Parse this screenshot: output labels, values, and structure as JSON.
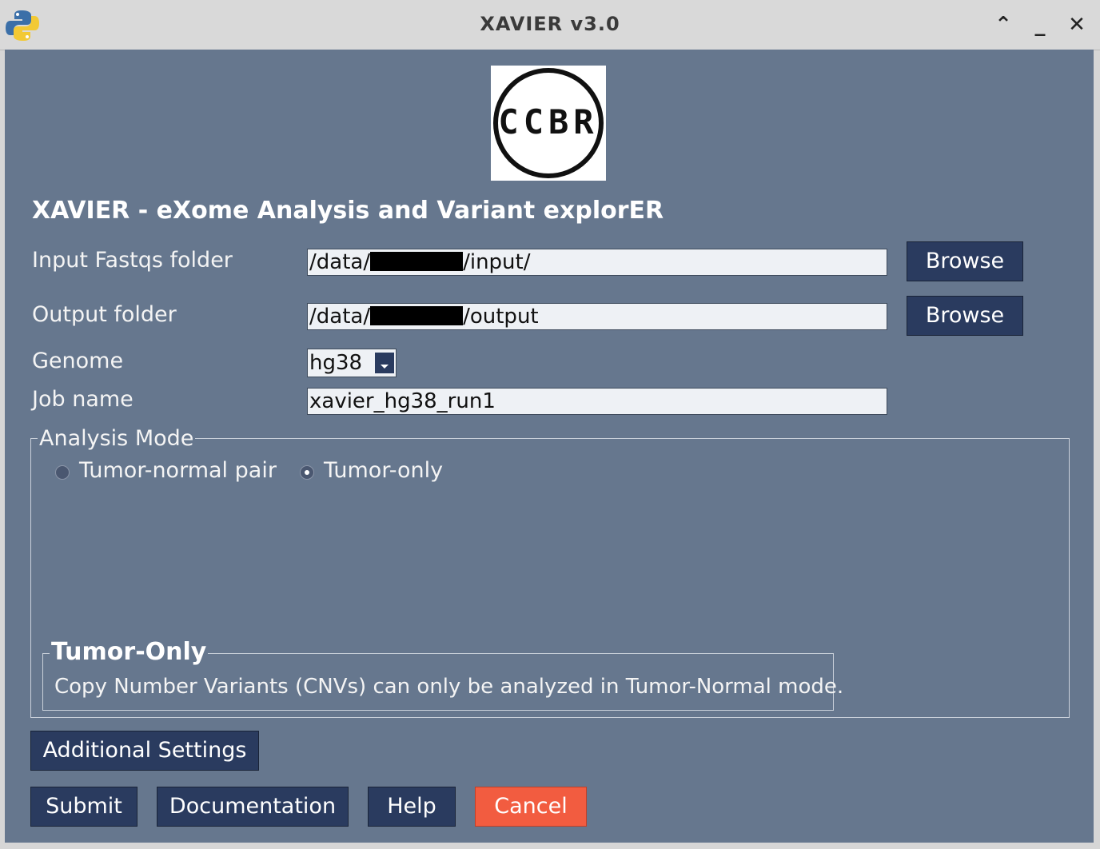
{
  "window": {
    "title": "XAVIER v3.0",
    "controls": {
      "maximize": "⌃",
      "minimize": "_",
      "close": "✕"
    }
  },
  "logo": {
    "text": "CCBR"
  },
  "heading": "XAVIER - eXome Analysis and Variant explorER",
  "form": {
    "input_label": "Input Fastqs folder",
    "input_value_prefix": "/data/",
    "input_value_suffix": "/input/",
    "output_label": "Output folder",
    "output_value_prefix": "/data/",
    "output_value_suffix": "/output",
    "browse_label": "Browse",
    "genome_label": "Genome",
    "genome_value": "hg38",
    "jobname_label": "Job name",
    "jobname_value": "xavier_hg38_run1"
  },
  "analysis_mode": {
    "legend": "Analysis Mode",
    "options": [
      "Tumor-normal pair",
      "Tumor-only"
    ],
    "selected": "Tumor-only",
    "info_legend": "Tumor-Only",
    "info_text": "Copy Number Variants (CNVs) can only be analyzed in Tumor-Normal mode."
  },
  "buttons": {
    "additional_settings": "Additional Settings",
    "submit": "Submit",
    "documentation": "Documentation",
    "help": "Help",
    "cancel": "Cancel"
  },
  "colors": {
    "background": "#66778e",
    "button": "#2a3b5f",
    "cancel": "#f25c40"
  }
}
